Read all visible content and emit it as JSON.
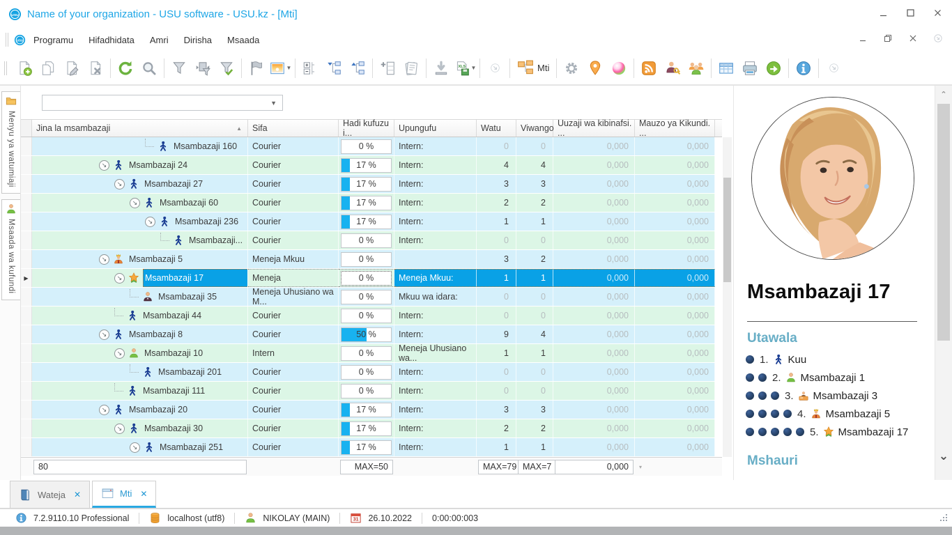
{
  "window": {
    "title": "Name of your organization - USU software - USU.kz - [Mti]",
    "controls": [
      "minimize",
      "maximize",
      "close"
    ],
    "mdi_controls": [
      "minimize",
      "restore",
      "close",
      "more"
    ]
  },
  "menu": {
    "items": [
      "Programu",
      "Hifadhidata",
      "Amri",
      "Dirisha",
      "Msaada"
    ]
  },
  "toolbar": {
    "mti_label": "Mti",
    "groups": [
      [
        "new-record",
        "copy-record",
        "edit-record",
        "delete-record"
      ],
      [
        "refresh",
        "search"
      ],
      [
        "filter",
        "filter-window",
        "filter-apply"
      ],
      [
        "flag",
        "image"
      ],
      [
        "expand-levels",
        "tree-expand",
        "tree-collapse"
      ],
      [
        "add-column",
        "report"
      ],
      [
        "import",
        "export-xls"
      ],
      [
        "more"
      ],
      [
        "tree-mti"
      ],
      [
        "settings",
        "location",
        "colors"
      ],
      [
        "rss",
        "user-access",
        "users"
      ],
      [
        "grid",
        "print",
        "go"
      ],
      [
        "info"
      ],
      [
        "more2"
      ]
    ]
  },
  "sidebar": {
    "tabs": [
      {
        "icon": "folder",
        "label": "Menyu ya watumiaji"
      },
      {
        "icon": "intern",
        "label": "Msaada wa kufundi"
      }
    ]
  },
  "filter_combo": {
    "value": ""
  },
  "table": {
    "columns": [
      {
        "label": "Jina la msambazaji",
        "sort": "asc"
      },
      {
        "label": "Sifa"
      },
      {
        "label": "Hadi kufuzu i..."
      },
      {
        "label": "Upungufu"
      },
      {
        "label": "Watu"
      },
      {
        "label": "Viwango"
      },
      {
        "label": "Uuzaji wa kibinafsi. ..."
      },
      {
        "label": "Mauzo ya Kikundi. ..."
      }
    ],
    "rows": [
      {
        "name": "Msambazaji 160",
        "icon": "courier",
        "indent": 7,
        "expand": false,
        "sifa": "Courier",
        "pct": 0,
        "pct_label": "0 %",
        "upungufu": "Intern:",
        "watu": "0",
        "viwango": "0",
        "uuzaji": "0,000",
        "mauzo": "0,000",
        "selected": false
      },
      {
        "name": "Msambazaji 24",
        "icon": "courier",
        "indent": 4,
        "expand": true,
        "sifa": "Courier",
        "pct": 17,
        "pct_label": "17 %",
        "upungufu": "Intern:",
        "watu": "4",
        "viwango": "4",
        "uuzaji": "0,000",
        "mauzo": "0,000",
        "selected": false
      },
      {
        "name": "Msambazaji 27",
        "icon": "courier",
        "indent": 5,
        "expand": true,
        "sifa": "Courier",
        "pct": 17,
        "pct_label": "17 %",
        "upungufu": "Intern:",
        "watu": "3",
        "viwango": "3",
        "uuzaji": "0,000",
        "mauzo": "0,000",
        "selected": false
      },
      {
        "name": "Msambazaji 60",
        "icon": "courier",
        "indent": 6,
        "expand": true,
        "sifa": "Courier",
        "pct": 17,
        "pct_label": "17 %",
        "upungufu": "Intern:",
        "watu": "2",
        "viwango": "2",
        "uuzaji": "0,000",
        "mauzo": "0,000",
        "selected": false
      },
      {
        "name": "Msambazaji 236",
        "icon": "courier",
        "indent": 7,
        "expand": true,
        "sifa": "Courier",
        "pct": 17,
        "pct_label": "17 %",
        "upungufu": "Intern:",
        "watu": "1",
        "viwango": "1",
        "uuzaji": "0,000",
        "mauzo": "0,000",
        "selected": false
      },
      {
        "name": "Msambazaji...",
        "icon": "courier",
        "indent": 8,
        "expand": false,
        "sifa": "Courier",
        "pct": 0,
        "pct_label": "0 %",
        "upungufu": "Intern:",
        "watu": "0",
        "viwango": "0",
        "uuzaji": "0,000",
        "mauzo": "0,000",
        "selected": false
      },
      {
        "name": "Msambazaji 5",
        "icon": "king",
        "indent": 4,
        "expand": true,
        "sifa": "Meneja Mkuu",
        "pct": 0,
        "pct_label": "0 %",
        "upungufu": "",
        "watu": "3",
        "viwango": "2",
        "uuzaji": "0,000",
        "mauzo": "0,000",
        "selected": false
      },
      {
        "name": "Msambazaji 17",
        "icon": "star",
        "indent": 5,
        "expand": true,
        "sifa": "Meneja",
        "pct": 0,
        "pct_label": "0 %",
        "upungufu": "Meneja Mkuu:",
        "watu": "1",
        "viwango": "1",
        "uuzaji": "0,000",
        "mauzo": "0,000",
        "selected": true
      },
      {
        "name": "Msambazaji 35",
        "icon": "manager",
        "indent": 6,
        "expand": false,
        "sifa": "Meneja Uhusiano wa M...",
        "pct": 0,
        "pct_label": "0 %",
        "upungufu": "Mkuu wa idara:",
        "watu": "0",
        "viwango": "0",
        "uuzaji": "0,000",
        "mauzo": "0,000",
        "selected": false
      },
      {
        "name": "Msambazaji 44",
        "icon": "courier",
        "indent": 5,
        "expand": false,
        "sifa": "Courier",
        "pct": 0,
        "pct_label": "0 %",
        "upungufu": "Intern:",
        "watu": "0",
        "viwango": "0",
        "uuzaji": "0,000",
        "mauzo": "0,000",
        "selected": false
      },
      {
        "name": "Msambazaji 8",
        "icon": "courier",
        "indent": 4,
        "expand": true,
        "sifa": "Courier",
        "pct": 50,
        "pct_label": "50 %",
        "upungufu": "Intern:",
        "watu": "9",
        "viwango": "4",
        "uuzaji": "0,000",
        "mauzo": "0,000",
        "selected": false
      },
      {
        "name": "Msambazaji 10",
        "icon": "intern",
        "indent": 5,
        "expand": true,
        "sifa": "Intern",
        "pct": 0,
        "pct_label": "0 %",
        "upungufu": "Meneja Uhusiano wa...",
        "watu": "1",
        "viwango": "1",
        "uuzaji": "0,000",
        "mauzo": "0,000",
        "selected": false
      },
      {
        "name": "Msambazaji 201",
        "icon": "courier",
        "indent": 6,
        "expand": false,
        "sifa": "Courier",
        "pct": 0,
        "pct_label": "0 %",
        "upungufu": "Intern:",
        "watu": "0",
        "viwango": "0",
        "uuzaji": "0,000",
        "mauzo": "0,000",
        "selected": false
      },
      {
        "name": "Msambazaji 111",
        "icon": "courier",
        "indent": 5,
        "expand": false,
        "sifa": "Courier",
        "pct": 0,
        "pct_label": "0 %",
        "upungufu": "Intern:",
        "watu": "0",
        "viwango": "0",
        "uuzaji": "0,000",
        "mauzo": "0,000",
        "selected": false
      },
      {
        "name": "Msambazaji 20",
        "icon": "courier",
        "indent": 4,
        "expand": true,
        "sifa": "Courier",
        "pct": 17,
        "pct_label": "17 %",
        "upungufu": "Intern:",
        "watu": "3",
        "viwango": "3",
        "uuzaji": "0,000",
        "mauzo": "0,000",
        "selected": false
      },
      {
        "name": "Msambazaji 30",
        "icon": "courier",
        "indent": 5,
        "expand": true,
        "sifa": "Courier",
        "pct": 17,
        "pct_label": "17 %",
        "upungufu": "Intern:",
        "watu": "2",
        "viwango": "2",
        "uuzaji": "0,000",
        "mauzo": "0,000",
        "selected": false
      },
      {
        "name": "Msambazaji 251",
        "icon": "courier",
        "indent": 6,
        "expand": true,
        "sifa": "Courier",
        "pct": 17,
        "pct_label": "17 %",
        "upungufu": "Intern:",
        "watu": "1",
        "viwango": "1",
        "uuzaji": "0,000",
        "mauzo": "0,000",
        "selected": false
      }
    ],
    "footer": {
      "name": "80",
      "pct": "MAX=50",
      "watu": "MAX=79",
      "viwango": "MAX=7",
      "uuzaji": "0,000"
    }
  },
  "profile": {
    "name": "Msambazaji 17",
    "utawala": {
      "title": "Utawala",
      "items": [
        {
          "level": 1,
          "num": "1.",
          "icon": "courier",
          "label": "Kuu"
        },
        {
          "level": 2,
          "num": "2.",
          "icon": "intern",
          "label": "Msambazaji 1"
        },
        {
          "level": 3,
          "num": "3.",
          "icon": "desk",
          "label": "Msambazaji 3"
        },
        {
          "level": 4,
          "num": "4.",
          "icon": "king",
          "label": "Msambazaji 5"
        },
        {
          "level": 5,
          "num": "5.",
          "icon": "star",
          "label": "Msambazaji 17"
        }
      ]
    },
    "mshauri_title": "Mshauri"
  },
  "bottom_tabs": {
    "tabs": [
      {
        "label": "Wateja",
        "icon": "book",
        "active": false
      },
      {
        "label": "Mti",
        "icon": "window",
        "active": true
      }
    ]
  },
  "status_bar": {
    "version": "7.2.9110.10 Professional",
    "database": "localhost (utf8)",
    "user": "NIKOLAY (MAIN)",
    "date": "26.10.2022",
    "timer": "0:00:00:003"
  },
  "accent_colors": {
    "title_blue": "#1ea6e6",
    "selection_blue": "#09a1e6",
    "row_blue": "#d5f0fb",
    "row_green": "#dcf6e6",
    "progress_blue": "#18b2f0",
    "heading_teal": "#68aec6"
  }
}
